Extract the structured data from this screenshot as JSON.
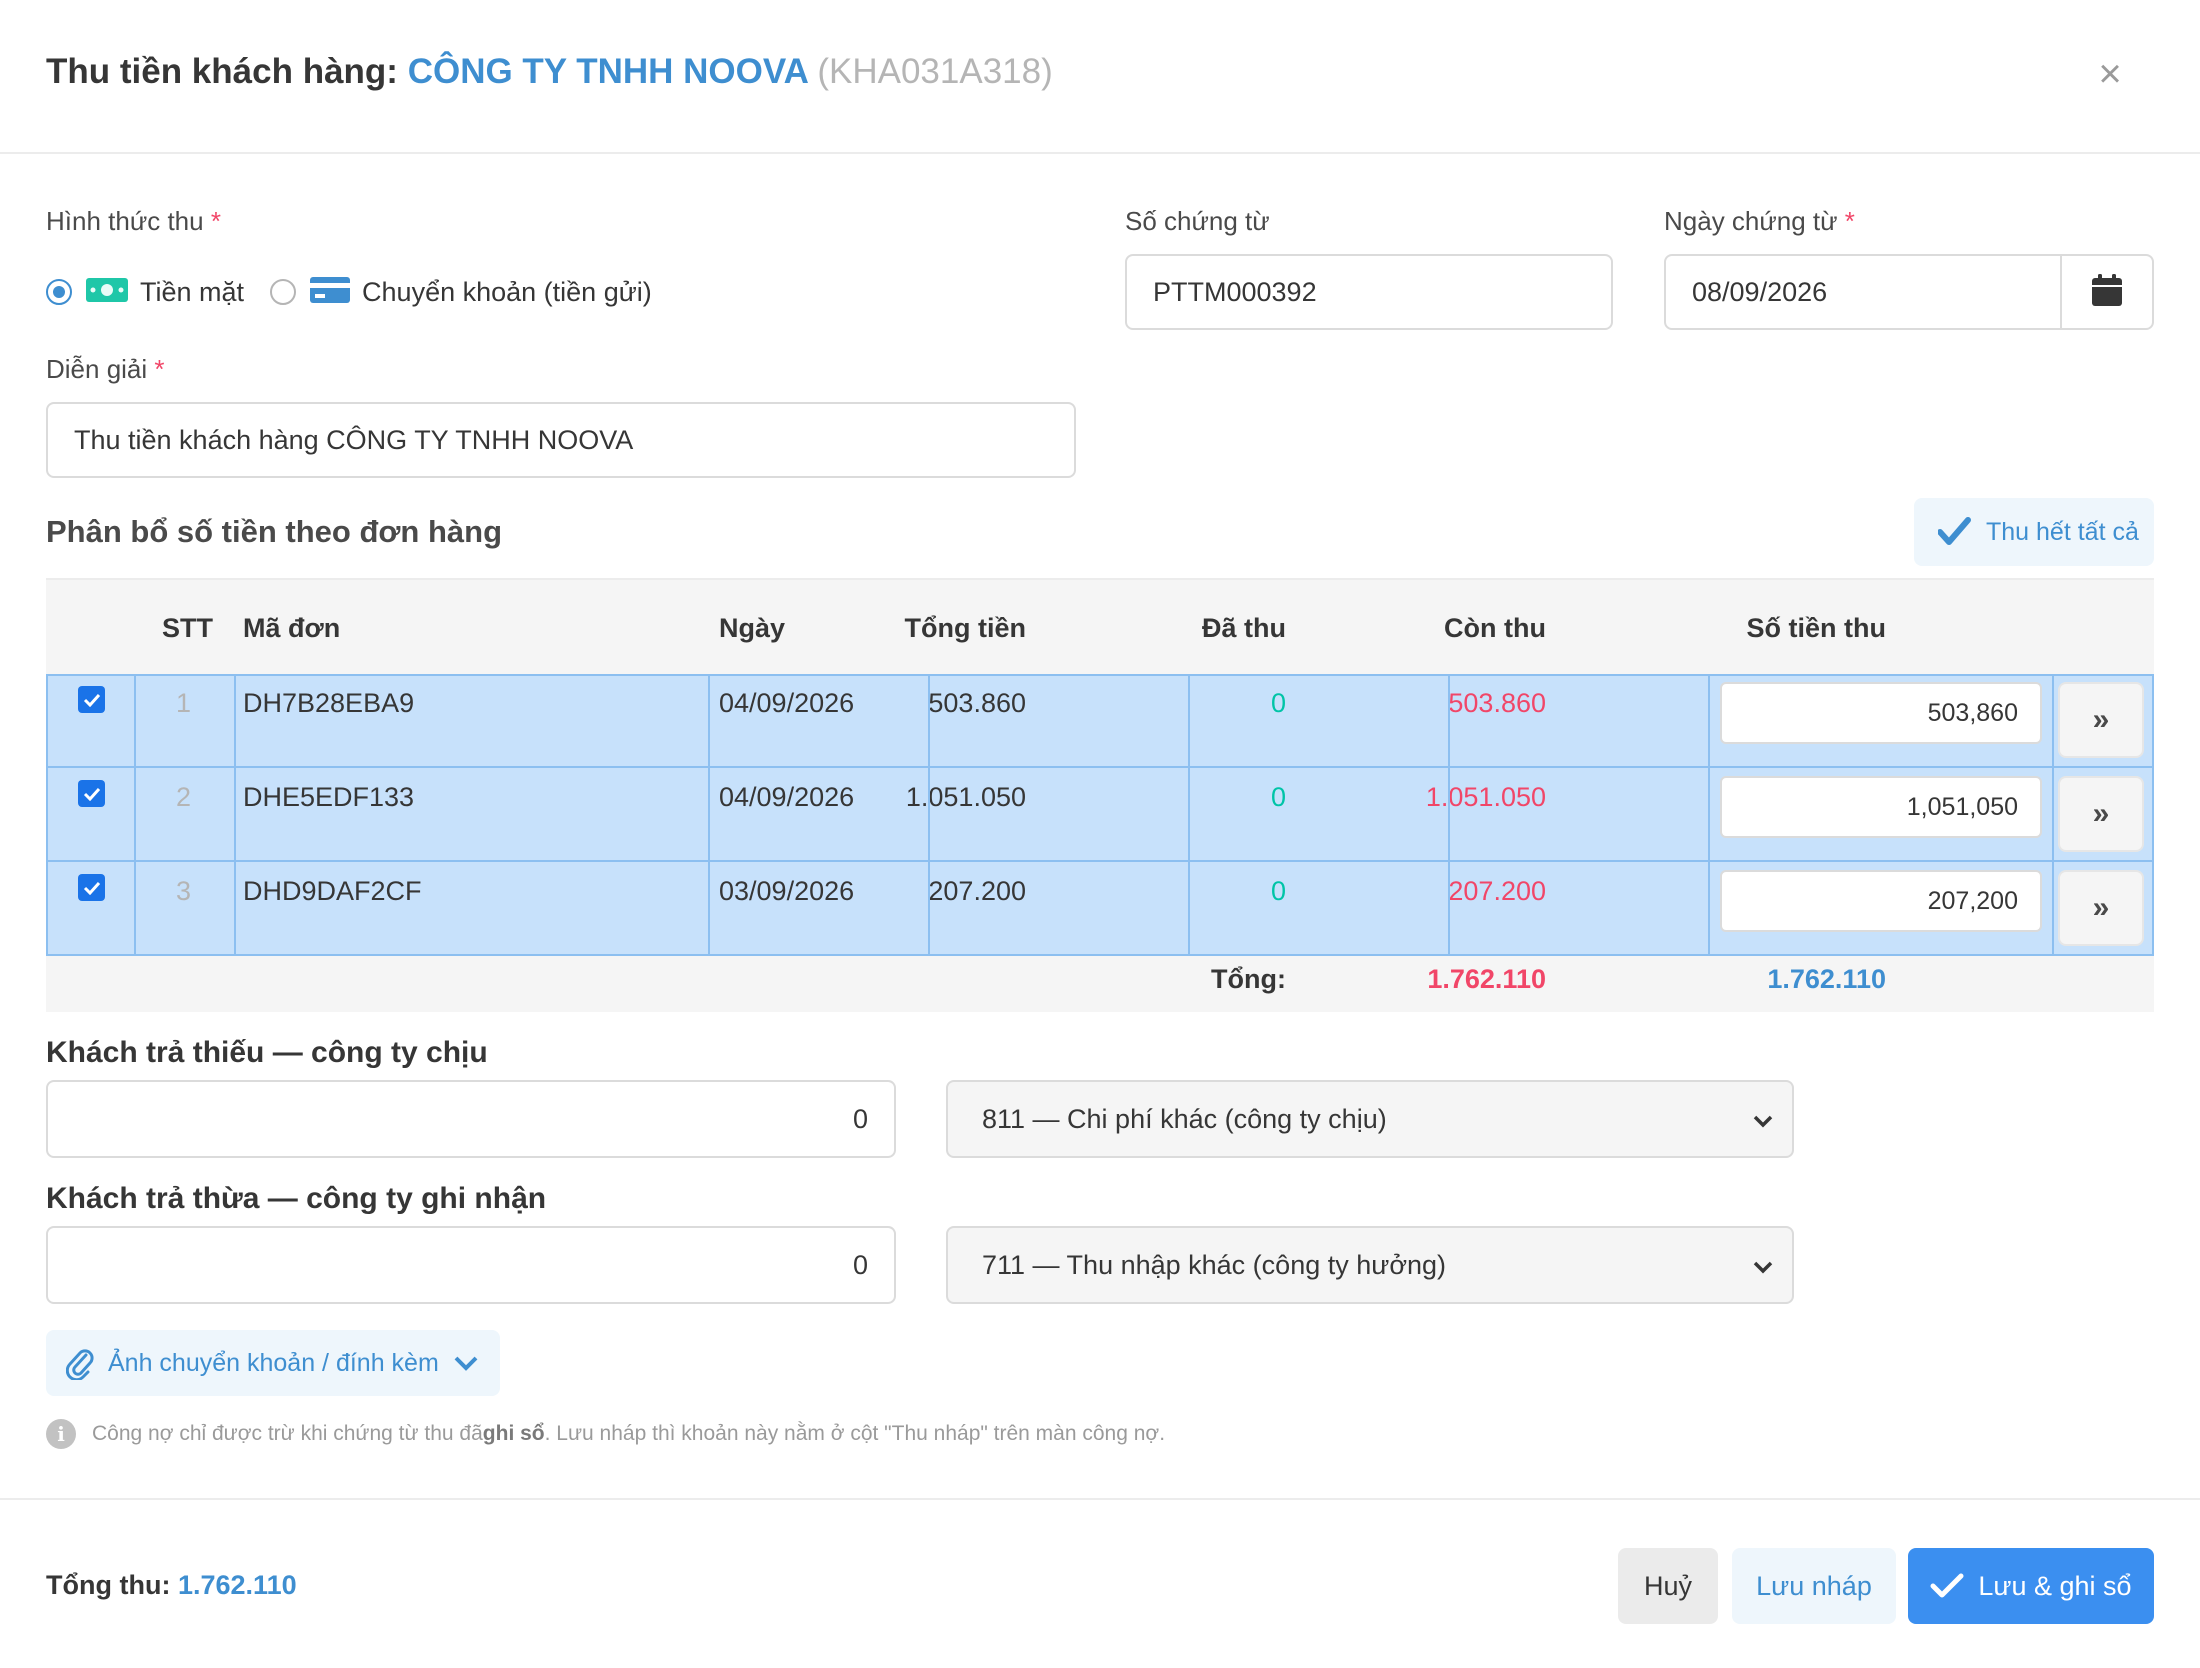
{
  "header": {
    "title_prefix": "Thu tiền khách hàng:",
    "customer_name": "CÔNG TY TNHH NOOVA",
    "customer_code": "(KHA031A318)"
  },
  "form": {
    "method_label": "Hình thức thu",
    "method_options": [
      {
        "label": "Tiền mặt",
        "selected": true,
        "icon": "money-icon"
      },
      {
        "label": "Chuyển khoản (tiền gửi)",
        "selected": false,
        "icon": "credit-card-icon"
      }
    ],
    "doc_no_label": "Số chứng từ",
    "doc_no_value": "PTTM000392",
    "doc_date_label": "Ngày chứng từ",
    "doc_date_value": "08/09/2026",
    "description_label": "Diễn giải",
    "description_value": "Thu tiền khách hàng CÔNG TY TNHH NOOVA",
    "required_mark": "*"
  },
  "allocation": {
    "title": "Phân bổ số tiền theo đơn hàng",
    "collect_all_label": "Thu hết tất cả",
    "columns": [
      "STT",
      "Mã đơn",
      "Ngày",
      "Tổng tiền",
      "Đã thu",
      "Còn thu",
      "Số tiền thu"
    ],
    "rows": [
      {
        "stt": "1",
        "code": "DH7B28EBA9",
        "date": "04/09/2026",
        "total": "503.860",
        "paid": "0",
        "remaining": "503.860",
        "amount": "503,860",
        "checked": true
      },
      {
        "stt": "2",
        "code": "DHE5EDF133",
        "date": "04/09/2026",
        "total": "1.051.050",
        "paid": "0",
        "remaining": "1.051.050",
        "amount": "1,051,050",
        "checked": true
      },
      {
        "stt": "3",
        "code": "DHD9DAF2CF",
        "date": "03/09/2026",
        "total": "207.200",
        "paid": "0",
        "remaining": "207.200",
        "amount": "207,200",
        "checked": true
      }
    ],
    "total_label": "Tổng:",
    "total_remaining": "1.762.110",
    "total_amount": "1.762.110",
    "fill_button_glyph": "»"
  },
  "underpay": {
    "title": "Khách trả thiếu — công ty chịu",
    "value": "0",
    "account": "811 — Chi phí khác (công ty chịu)"
  },
  "overpay": {
    "title": "Khách trả thừa — công ty ghi nhận",
    "value": "0",
    "account": "711 — Thu nhập khác (công ty hưởng)"
  },
  "attachment": {
    "label": "Ảnh chuyển khoản / đính kèm"
  },
  "note": {
    "before": "Công nợ chỉ được trừ khi chứng từ thu đã ",
    "bold": "ghi sổ",
    "after": ". Lưu nháp thì khoản này nằm ở cột \"Thu nháp\" trên màn công nợ."
  },
  "footer": {
    "total_label": "Tổng thu:",
    "total_value": "1.762.110",
    "cancel_label": "Huỷ",
    "draft_label": "Lưu nháp",
    "post_label": "Lưu & ghi sổ"
  },
  "colors": {
    "primary": "#3e8ed0",
    "danger": "#f14668",
    "teal": "#00c4a7",
    "row_selected": "#c7e1fb",
    "post_button": "#3b8ff0"
  }
}
